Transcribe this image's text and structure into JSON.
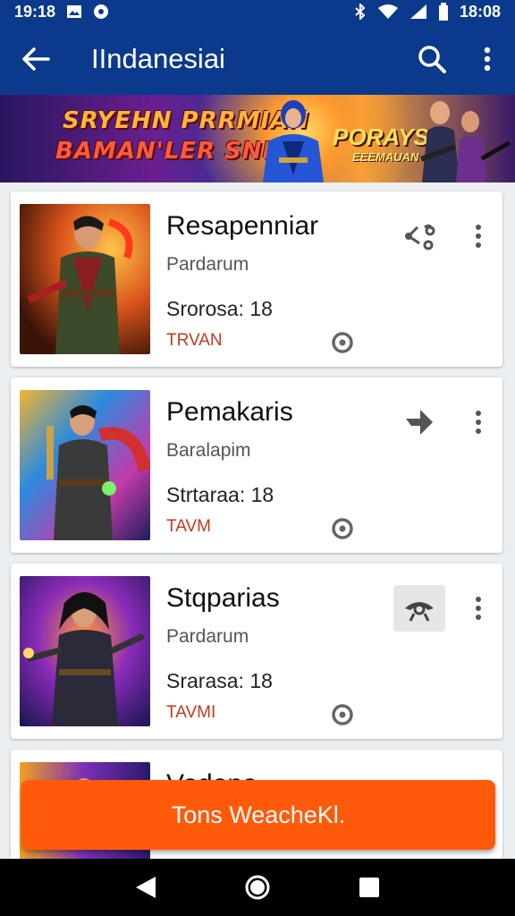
{
  "status_bar": {
    "time_left": "19:18",
    "time_right": "18:08"
  },
  "app_bar": {
    "title": "IIndanesiai"
  },
  "banner": {
    "line1": "SRYEHN PRRMIAN",
    "line2": "BAMAN'LER SNER!",
    "line3": "PORAYSH",
    "line4": "EEEMAUAN"
  },
  "cards": [
    {
      "name": "Resapenniar",
      "subtitle": "Pardarum",
      "stat": "Srorosa: 18",
      "tag": "TRVAN",
      "action_icon": "share-nodes-icon"
    },
    {
      "name": "Pemakaris",
      "subtitle": "Baralapim",
      "stat": "Strtaraa: 18",
      "tag": "TAVM",
      "action_icon": "forward-arrow-icon"
    },
    {
      "name": "Stqparias",
      "subtitle": "Pardarum",
      "stat": "Srarasa: 18",
      "tag": "TAVMI",
      "action_icon": "view-icon"
    },
    {
      "name": "Vodone",
      "subtitle": "",
      "stat": "",
      "tag": "",
      "action_icon": "share-nodes-icon"
    }
  ],
  "toast": {
    "text": "Tons WeacheKl."
  },
  "colors": {
    "primary": "#0b3a8c",
    "accent": "#ff5a0a",
    "tag": "#c23a1c"
  }
}
